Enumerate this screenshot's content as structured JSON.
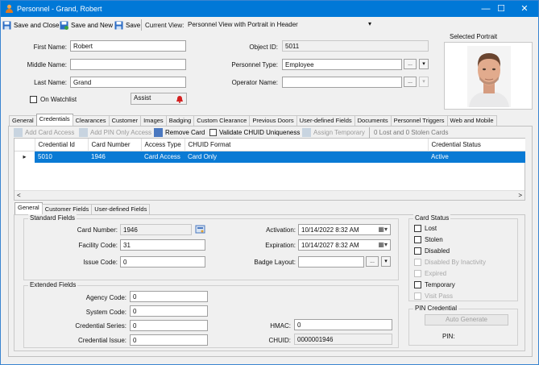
{
  "window": {
    "title": "Personnel - Grand, Robert",
    "minimize": "—",
    "maximize": "☐",
    "close": "✕"
  },
  "toolbar": {
    "save_close": "Save and Close",
    "save_new": "Save and New",
    "save": "Save",
    "current_view_label": "Current View:",
    "current_view_value": "Personnel View with Portrait in Header"
  },
  "header": {
    "first_name_label": "First Name:",
    "first_name": "Robert",
    "middle_name_label": "Middle Name:",
    "middle_name": "",
    "last_name_label": "Last Name:",
    "last_name": "Grand",
    "watchlist_label": "On Watchlist",
    "assist_label": "Assist",
    "object_id_label": "Object ID:",
    "object_id": "5011",
    "personnel_type_label": "Personnel Type:",
    "personnel_type": "Employee",
    "operator_name_label": "Operator Name:",
    "operator_name": "",
    "portrait_label": "Selected Portrait",
    "browse": "...",
    "dropdown": "▾"
  },
  "tabs": [
    "General",
    "Credentials",
    "Clearances",
    "Customer",
    "Images",
    "Badging",
    "Custom Clearance",
    "Previous Doors",
    "User-defined Fields",
    "Documents",
    "Personnel Triggers",
    "Web and Mobile"
  ],
  "cred_toolbar": {
    "add_card": "Add Card Access",
    "add_pin": "Add PIN Only Access",
    "remove_card": "Remove Card",
    "validate": "Validate CHUID Uniqueness",
    "assign_temp": "Assign Temporary",
    "status": "0 Lost and 0 Stolen Cards"
  },
  "grid": {
    "columns": [
      "Credential Id",
      "Card Number",
      "Access Type",
      "CHUID Format",
      "Credential Status"
    ],
    "rows": [
      {
        "id": "5010",
        "card": "1946",
        "access": "Card Access",
        "chuid": "Card Only",
        "status": "Active"
      }
    ],
    "row_marker": "▸",
    "scroll_left": "<",
    "scroll_right": ">"
  },
  "subtabs": [
    "General",
    "Customer Fields",
    "User-defined Fields"
  ],
  "standard": {
    "title": "Standard Fields",
    "card_number_label": "Card Number:",
    "card_number": "1946",
    "facility_label": "Facility Code:",
    "facility": "31",
    "issue_label": "Issue Code:",
    "issue": "0",
    "activation_label": "Activation:",
    "activation": "10/14/2022   8:32 AM",
    "expiration_label": "Expiration:",
    "expiration": "10/14/2027   8:32 AM",
    "badge_layout_label": "Badge Layout:",
    "badge_layout": ""
  },
  "extended": {
    "title": "Extended Fields",
    "agency_label": "Agency Code:",
    "agency": "0",
    "system_label": "System Code:",
    "system": "0",
    "series_label": "Credential Series:",
    "series": "0",
    "cred_issue_label": "Credential Issue:",
    "cred_issue": "0",
    "hmac_label": "HMAC:",
    "hmac": "0",
    "chuid_label": "CHUID:",
    "chuid": "0000001946"
  },
  "card_status": {
    "title": "Card Status",
    "items": [
      {
        "label": "Lost",
        "enabled": true
      },
      {
        "label": "Stolen",
        "enabled": true
      },
      {
        "label": "Disabled",
        "enabled": true
      },
      {
        "label": "Disabled By Inactivity",
        "enabled": false
      },
      {
        "label": "Expired",
        "enabled": false
      },
      {
        "label": "Temporary",
        "enabled": true
      },
      {
        "label": "Visit Pass",
        "enabled": false
      }
    ]
  },
  "pin": {
    "title": "PIN Credential",
    "auto_generate": "Auto Generate",
    "pin_label": "PIN:"
  }
}
